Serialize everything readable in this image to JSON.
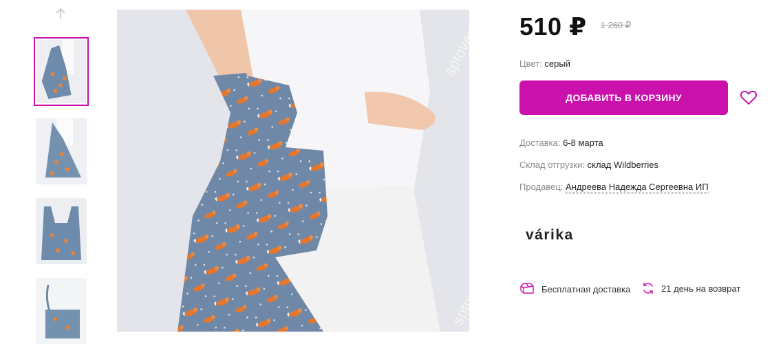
{
  "gallery": {
    "up_icon": "arrow-up-icon",
    "thumbnails": [
      {
        "alt": "thumbnail-1",
        "selected": true
      },
      {
        "alt": "thumbnail-2",
        "selected": false
      },
      {
        "alt": "thumbnail-3",
        "selected": false
      },
      {
        "alt": "thumbnail-4",
        "selected": false
      }
    ],
    "watermark": "sptovar"
  },
  "product": {
    "price": "510 ₽",
    "old_price": "1 260 ₽",
    "color_label": "Цвет:",
    "color_value": "серый",
    "add_to_cart": "ДОБАВИТЬ В КОРЗИНУ",
    "delivery_label": "Доставка:",
    "delivery_value": "6-8 марта",
    "warehouse_label": "Склад отгрузки:",
    "warehouse_value": "склад Wildberries",
    "seller_label": "Продавец:",
    "seller_value": "Андреева Надежда Сергеевна ИП",
    "brand": "várika"
  },
  "perks": {
    "free_delivery": "Бесплатная доставка",
    "return": "21 день на возврат"
  },
  "colors": {
    "accent": "#cb11ab",
    "text": "#242424",
    "muted": "#8c8c8c"
  }
}
